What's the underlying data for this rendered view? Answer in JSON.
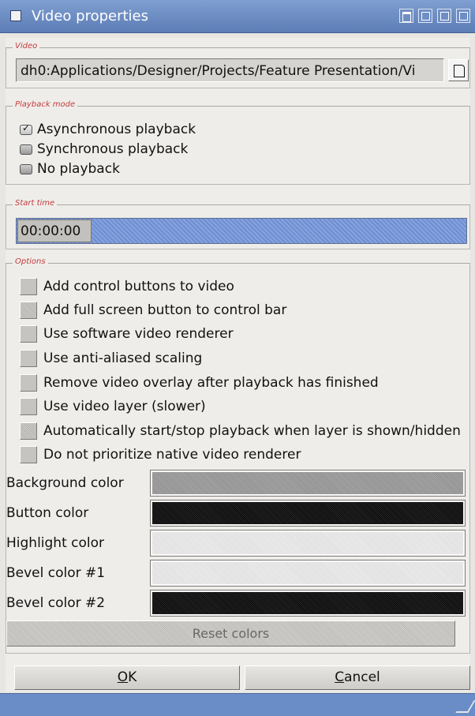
{
  "window": {
    "title": "Video properties"
  },
  "video": {
    "legend": "Video",
    "path": "dh0:Applications/Designer/Projects/Feature Presentation/Vi"
  },
  "playback": {
    "legend": "Playback mode",
    "options": [
      {
        "label": "Asynchronous playback",
        "selected": true
      },
      {
        "label": "Synchronous playback",
        "selected": false
      },
      {
        "label": "No playback",
        "selected": false
      }
    ]
  },
  "start_time": {
    "legend": "Start time",
    "value": "00:00:00"
  },
  "options": {
    "legend": "Options",
    "checks": [
      {
        "label": "Add control buttons to video",
        "checked": false,
        "disabled": false
      },
      {
        "label": "Add full screen button to control bar",
        "checked": false,
        "disabled": true
      },
      {
        "label": "Use software video renderer",
        "checked": false,
        "disabled": false
      },
      {
        "label": "Use anti-aliased scaling",
        "checked": false,
        "disabled": false
      },
      {
        "label": "Remove video overlay after playback has finished",
        "checked": false,
        "disabled": false
      },
      {
        "label": "Use video layer (slower)",
        "checked": false,
        "disabled": false
      },
      {
        "label": "Automatically start/stop playback when layer is shown/hidden",
        "checked": false,
        "disabled": true
      },
      {
        "label": "Do not prioritize native video renderer",
        "checked": false,
        "disabled": false
      }
    ],
    "colors": [
      {
        "label": "Background color",
        "color": "#9a9a9a"
      },
      {
        "label": "Button color",
        "color": "#111111"
      },
      {
        "label": "Highlight color",
        "color": "#e4e4e4"
      },
      {
        "label": "Bevel color #1",
        "color": "#e4e4e4"
      },
      {
        "label": "Bevel color #2",
        "color": "#111111"
      }
    ],
    "reset_label": "Reset colors"
  },
  "buttons": {
    "ok_prefix": "",
    "ok_key": "O",
    "ok_rest": "K",
    "cancel_key": "C",
    "cancel_rest": "ancel"
  }
}
